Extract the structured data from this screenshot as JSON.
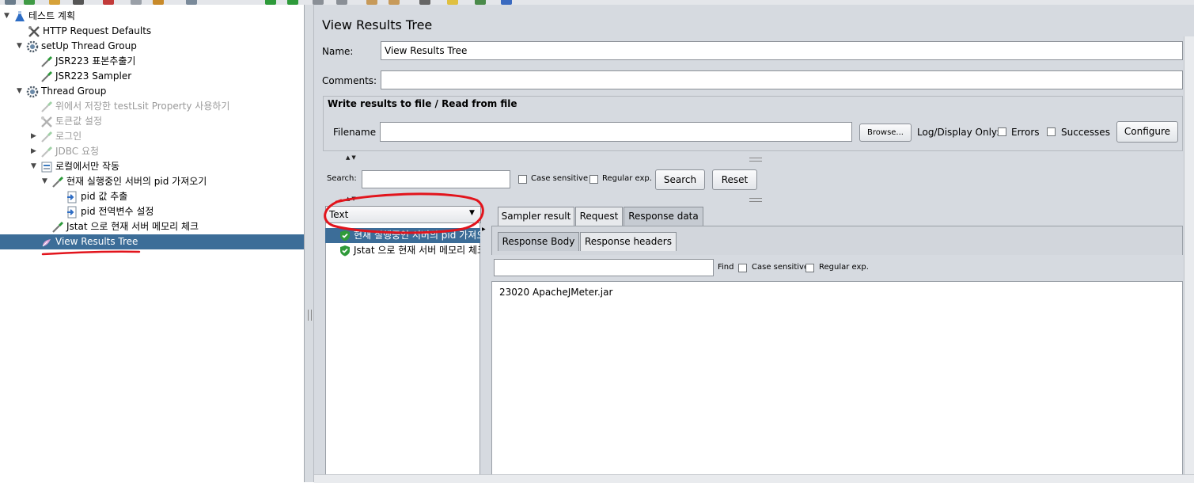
{
  "tree": {
    "items": [
      {
        "label": "테스트 계획",
        "toggle": "▼",
        "icon": "flask-icon",
        "disabled": false
      },
      {
        "label": "HTTP Request Defaults",
        "toggle": "",
        "icon": "wrench-icon",
        "disabled": false
      },
      {
        "label": "setUp Thread Group",
        "toggle": "▼",
        "icon": "gear-icon",
        "disabled": false
      },
      {
        "label": "JSR223 표본추출기",
        "toggle": "",
        "icon": "pipette-icon",
        "disabled": false
      },
      {
        "label": "JSR223 Sampler",
        "toggle": "",
        "icon": "pipette-icon",
        "disabled": false
      },
      {
        "label": "Thread Group",
        "toggle": "▼",
        "icon": "gear-icon",
        "disabled": false
      },
      {
        "label": "위에서 저장한 testLsit  Property 사용하기",
        "toggle": "",
        "icon": "pipette-icon",
        "disabled": true
      },
      {
        "label": "토큰값 설정",
        "toggle": "",
        "icon": "wrench-icon",
        "disabled": true
      },
      {
        "label": "로그인",
        "toggle": "▶",
        "icon": "pipette-icon",
        "disabled": true
      },
      {
        "label": "JDBC 요청",
        "toggle": "▶",
        "icon": "pipette-icon",
        "disabled": true
      },
      {
        "label": "로컬에서만 작동",
        "toggle": "▼",
        "icon": "controller-icon",
        "disabled": false
      },
      {
        "label": "현재 실행중인 서버의 pid 가져오기",
        "toggle": "▼",
        "icon": "pipette-icon",
        "disabled": false
      },
      {
        "label": "pid 값 추출",
        "toggle": "",
        "icon": "postprocessor-icon",
        "disabled": false
      },
      {
        "label": "pid 전역변수 설정",
        "toggle": "",
        "icon": "postprocessor-icon",
        "disabled": false
      },
      {
        "label": "Jstat 으로 현재 서버 메모리 체크",
        "toggle": "",
        "icon": "pipette-icon",
        "disabled": false
      },
      {
        "label": "View Results Tree",
        "toggle": "",
        "icon": "listener-icon",
        "disabled": false,
        "selected": true
      }
    ]
  },
  "panel": {
    "title": "View Results Tree",
    "name_label": "Name:",
    "name_value": "View Results Tree",
    "comments_label": "Comments:",
    "comments_value": "",
    "file_group_title": "Write results to file / Read from file",
    "filename_label": "Filename",
    "filename_value": "",
    "browse_label": "Browse...",
    "log_display_label": "Log/Display Only:",
    "errors_label": "Errors",
    "successes_label": "Successes",
    "configure_label": "Configure",
    "search_label": "Search:",
    "search_value": "",
    "case_sensitive_label": "Case sensitive",
    "regex_label": "Regular exp.",
    "search_button": "Search",
    "reset_button": "Reset"
  },
  "renderer": {
    "selected": "Text",
    "arrow": "▼"
  },
  "results": [
    {
      "label": "현재 실행중인 서버의 pid 가져오기",
      "status": "success"
    },
    {
      "label": "Jstat 으로 현재 서버 메모리 체크",
      "status": "success"
    }
  ],
  "tabs": {
    "main": [
      "Sampler result",
      "Request",
      "Response data"
    ],
    "main_active": 2,
    "sub": [
      "Response Body",
      "Response headers"
    ],
    "sub_active": 0
  },
  "response": {
    "find_label": "Find",
    "find_value": "",
    "case_sensitive_label": "Case sensitive",
    "regex_label": "Regular exp.",
    "body": "23020 ApacheJMeter.jar"
  },
  "colors": {
    "selection": "#3c6d98",
    "annotation": "#e2141c",
    "success": "#2f9a3a"
  }
}
